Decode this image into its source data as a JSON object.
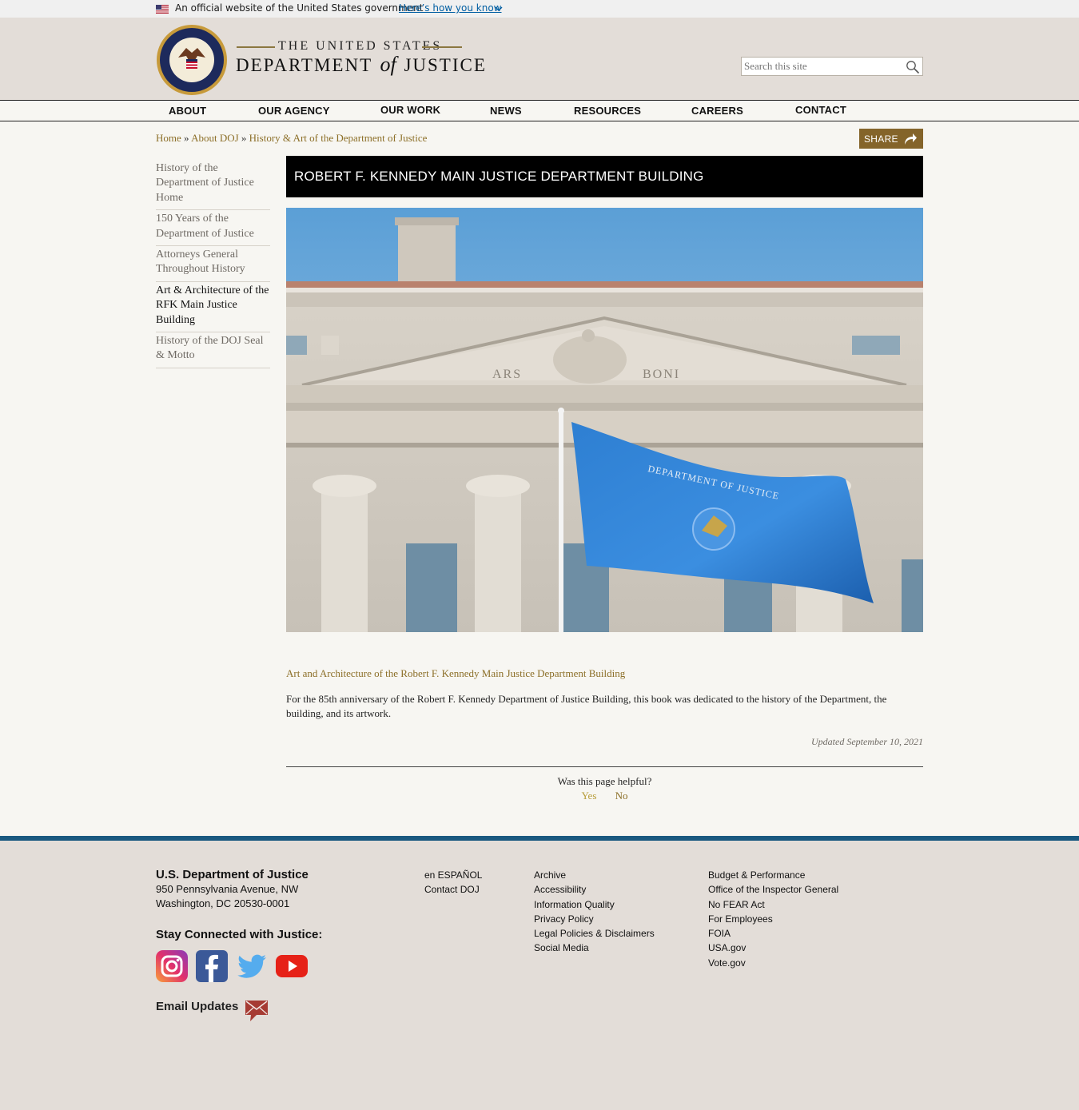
{
  "banner": {
    "text": "An official website of the United States government",
    "link": "Here’s how you know"
  },
  "header": {
    "wordmark_top": "THE UNITED STATES",
    "wordmark_dept": "DEPARTMENT",
    "wordmark_of": "of",
    "wordmark_justice": "JUSTICE",
    "search_placeholder": "Search this site"
  },
  "nav": {
    "items": [
      "ABOUT",
      "OUR AGENCY",
      "OUR WORK",
      "NEWS",
      "RESOURCES",
      "CAREERS",
      "CONTACT"
    ]
  },
  "breadcrumb": {
    "home": "Home",
    "sep": "»",
    "about": "About DOJ",
    "current": "History & Art of the Department of Justice"
  },
  "share": {
    "label": "SHARE"
  },
  "sidebar": {
    "items": [
      "History of the Department of Justice Home",
      "150 Years of the Department of Justice",
      "Attorneys General Throughout History",
      "Art & Architecture of the RFK Main Justice Building",
      "History of the DOJ Seal & Motto"
    ],
    "active_index": 3
  },
  "main": {
    "title": "ROBERT F. KENNEDY MAIN JUSTICE DEPARTMENT BUILDING",
    "photo_text": {
      "pediment_left": "ARS",
      "pediment_right": "BONI",
      "flag_text": "DEPARTMENT OF JUSTICE"
    },
    "caption_link": "Art and Architecture of the Robert F. Kennedy Main Justice Department Building",
    "body": "For the 85th anniversary of the Robert F. Kennedy Department of Justice Building, this book was dedicated to the history of the Department, the building, and its artwork.",
    "updated": "Updated September 10, 2021",
    "helpful_q": "Was this page helpful?",
    "yes": "Yes",
    "no": "No"
  },
  "footer": {
    "org": "U.S. Department of Justice",
    "addr1": "950 Pennsylvania Avenue, NW",
    "addr2": "Washington, DC 20530-0001",
    "stay": "Stay Connected with Justice:",
    "email": "Email Updates",
    "col1": [
      "en ESPAÑOL",
      "Contact DOJ"
    ],
    "col2": [
      "Archive",
      "Accessibility",
      "Information Quality",
      "Privacy Policy",
      "Legal Policies & Disclaimers",
      "Social Media"
    ],
    "col3": [
      "Budget & Performance",
      "Office of the Inspector General",
      "No FEAR Act",
      "For Employees",
      "FOIA",
      "USA.gov",
      "Vote.gov"
    ]
  },
  "colors": {
    "gold_link": "#8c6f28",
    "share_bg": "#84642a",
    "header_bg": "#e3ddd8",
    "footer_rule": "#1a5980"
  },
  "icons": [
    "us-flag-icon",
    "chevron-down-icon",
    "doj-seal-logo",
    "search-icon",
    "share-arrow-icon",
    "instagram-icon",
    "facebook-icon",
    "twitter-icon",
    "youtube-icon",
    "mail-icon"
  ]
}
